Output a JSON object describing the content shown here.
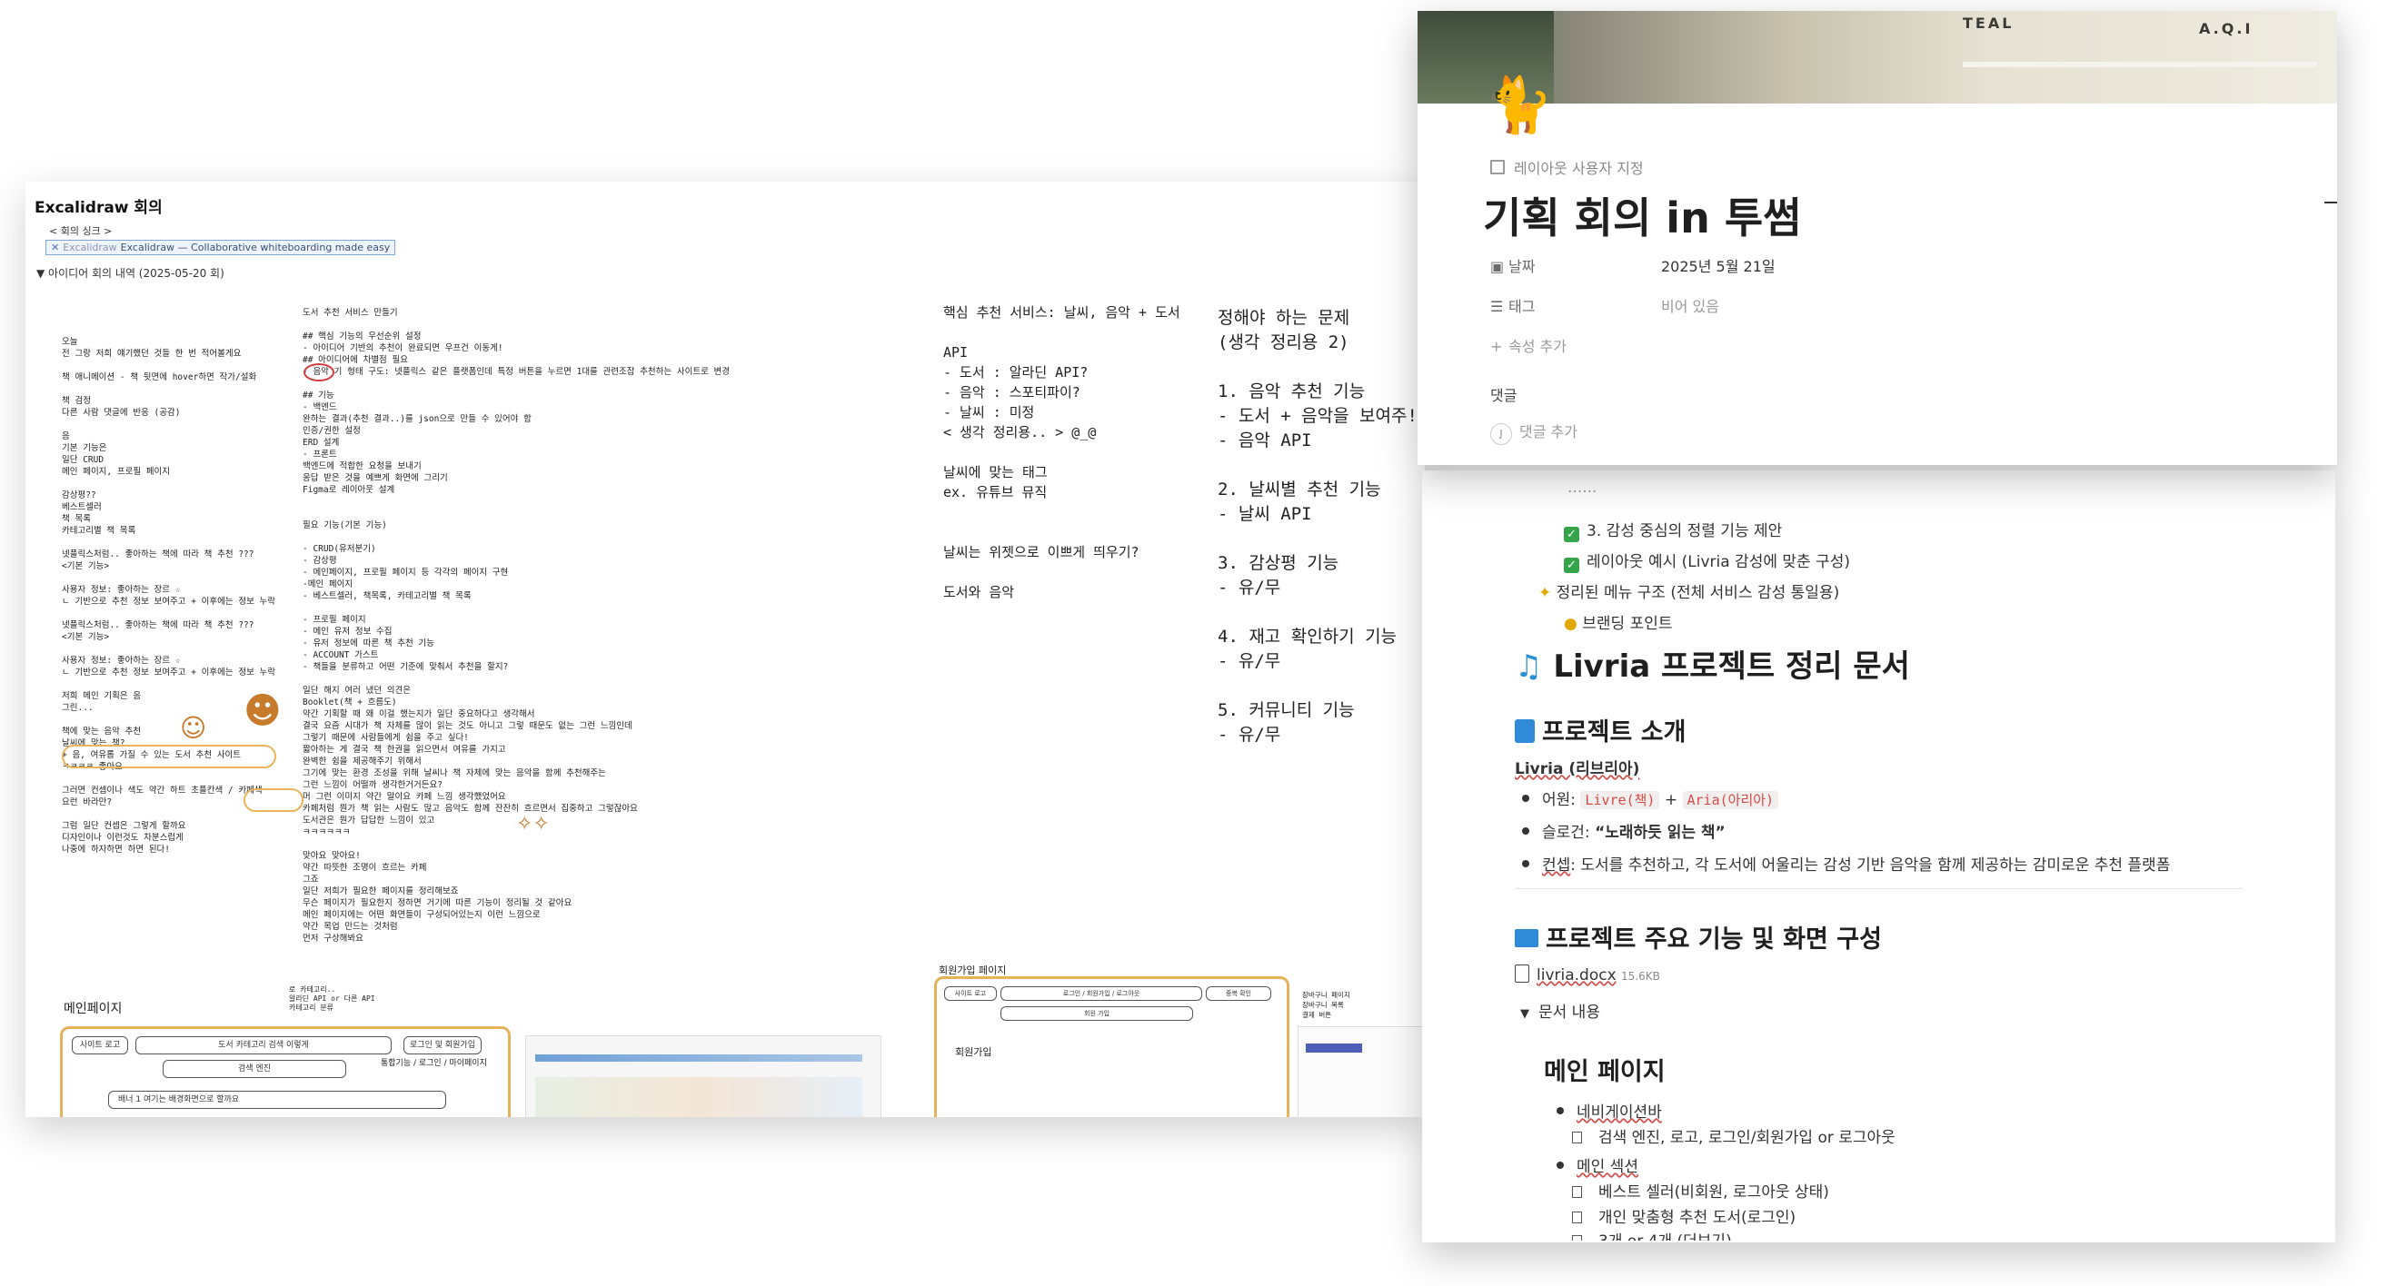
{
  "excalidraw": {
    "title": "Excalidraw 회의",
    "sync_label": "< 회의 싱크 >",
    "link_icon": "excalidraw-x-icon",
    "link_text_prefix": "Excalidraw",
    "link_text": "Excalidraw — Collaborative whiteboarding made easy",
    "toggle_label": "아이디어 회의 내역 (2025-05-20 회)",
    "notes": {
      "col1": "오늘\n전 그랑 저희 얘기했던 것들 한 번 적어볼게요\n\n책 애니메이션 - 책 뒷면에 hover하면 작가/설화\n\n책 검정\n다른 사람 댓글에 반응 (공감)\n\n음\n기본 기능은\n일단 CRUD\n메인 페이지, 프로필 페이지\n\n감상평??\n베스트셀러\n책 목록\n카테고리별 책 목록\n\n넷플릭스처럼.. 좋아하는 책에 따라 책 추천 ???\n<기본 기능>\n\n사용자 정보: 좋아하는 장르 ☆\nㄴ 기반으로 추천 정보 보여주고 + 이후에는 정보 누락\n\n넷플릭스처럼.. 좋아하는 책에 따라 책 추천 ???\n<기본 기능>\n\n사용자 정보: 좋아하는 장르 ☆\nㄴ 기반으로 추천 정보 보여주고 + 이후에는 정보 누락\n\n저희 메인 기획은 음\n그린...\n\n책에 맞는 음악 추천\n날씨에 맞는 책?\n+ 음, 여유롭 가질 수 있는 도서 추천 사이트\nㅋㅋㅋㅋ 좋아요\n\n그러면 컨셉이나 색도 약간 하트 초플칸색 / 카페색\n요런 바라만?\n\n그럼 일단 컨셉은 그렇게 할까요\n디자인이나 이런것도 차분스럽게\n나중에 하자하면 하면 된다!",
      "col2": "도서 추천 서비스 만들기\n\n## 핵심 기능의 우선순위 설정\n- 아이디어 기반의 추천이 완료되면 우프건 이동게!\n## 아이디어에 차별점 필요\n- 음악 기 형태 구도: 넷플릭스 같은 플랫폼인데 특정 버튼을 누르면 1대를 관련조잡 추천하는 사이트로 변경\n\n## 기능\n- 백엔드\n  완하는 결과(추천 결과..)를 json으로 만들 수 있어야 함\n  인증/권한 설정\n  ERD 설계\n- 프론트\n  백엔드에 적합한 요청을 보내기\n  응답 받은 것을 예쁘게 화면에 그리기\n  Figma로 레이아웃 설계\n\n\n필요 기능(기본 기능)\n\n- CRUD(유저분기)\n  - 감상평\n- 메인페이지, 프로필 페이지 등 각각의 페이지 구현\n  -메인 페이지\n    - 베스트셀러, 책목록, 카테고리별 책 목록\n\n  - 프로필 페이지\n    - 메인 유저 정보 수집\n    - 유저 정보에 따른 책 추천 기능\n      - ACCOUNT 가스트\n      - 책들을 분류하고 어떤 기준에 맞춰서 추천을 할지?\n\n일단 해지 여러 냈던 의견은\nBooklet(책 + 흐름도)\n약간 기획할 때 왜 이걸 했는지가 일단 중요하다고 생각해서\n결국 요즘 시대가 책 자체를 많이 읽는 것도 아니고 그렇 때문도 없는 그런 느낌인데\n그렇기 때문에 사람들에게 쉼을 주고 싶다!\n짧아하는 게 결국 책 한권을 읽으면서 여유를 가지고\n완벽한 쉼을 제공해주기 위해서\n그기에 맞는 환경 조성을 위해 날씨나 책 자체에 맞는 음악을 함께 추천해주는\n그런 느낌이 어떨까 생각한거거든요?\n머 그런 이미지 약간 말이요 카페 느낌 생각했었어요\n카페처럼 뭔가 책 읽는 사람도 많고 음악도 함께 잔잔히 흐르면서 집중하고 그렇잖아요\n도서관은 뭔가 답답한 느낌이 있고\nㅋㅋㅋㅋㅋㅋ\n\n맞아요 맞아요!\n약간 따뜻한 조명이 흐르는 카페\n그죠\n일단 저희가 필요한 페이지를 정리해보죠\n무슨 페이지가 필요한지 정하면 거기에 따른 기능이 정리될 것 같아요\n메인 페이지에는 어떤 화면들이 구성되어있는지 이런 느낌으로\n약간 목업 만드는 것처럼\n먼저 구상해봐요",
      "col3": "핵심 추천 서비스: 날씨, 음악 + 도서\n\nAPI\n- 도서 : 알라딘 API?\n- 음악 : 스포티파이?\n- 날씨 : 미정\n< 생각 정리용.. > @_@\n\n날씨에 맞는 태그\nex. 유튜브 뮤직\n\n\n날씨는 위젯으로 이쁘게 띄우기?\n\n도서와 음악",
      "col4": "정해야 하는 문제\n(생각 정리용 2)\n\n1. 음악 추천 기능\n- 도서 + 음악을 보여주!\n- 음악 API\n\n2. 날씨별 추천 기능\n- 날씨 API\n\n3. 감상평 기능\n- 유/무\n\n4. 재고 확인하기 기능\n- 유/무\n\n5. 커뮤니티 기능\n- 유/무"
    },
    "wireframe": {
      "main_page_label": "메인페이지",
      "callout": "로 카테고리..\n알라딘 API or 다른 API\n카테고리 분류",
      "search_box": "도서 카테고리 검색 이렇게",
      "logo_box": "사이트 로고",
      "login_box": "로그인 및 회원가입",
      "nav_text": "통합기능 / 로그인 / 마이페이지",
      "search_btn": "검색 엔진",
      "banner_text": "배너 1  여기는 배경화면으로 할까요",
      "signup_title": "회원가입 페이지",
      "signup_label": "회원가입",
      "signup_box1": "사이트 로고",
      "signup_box2": "로그인 / 회원가입 / 로그아웃",
      "signup_box3": "중복 확인",
      "signup_box4": "회원 가입",
      "side_title": "장바구니 페이지\n장바구니 목록\n결제 버튼"
    }
  },
  "notion": {
    "cover_sign_1": "TEAL",
    "cover_sign_2": "A.Q.I",
    "page_icon": "black-cat-icon",
    "layout_note": "레이아웃 사용자 지정",
    "title": "기획 회의 in 투썸",
    "props": {
      "date_label": "날짜",
      "date_value": "2025년 5월 21일",
      "tags_label": "태그",
      "tags_value": "비어 있음",
      "add_prop": "속성 추가"
    },
    "comments_label": "댓글",
    "comment_add": "댓글 추가",
    "comment_avatar": "J",
    "checklist": [
      "3. 감성 중심의 정렬 기능 제안",
      "레이아웃 예시 (Livria 감성에 맞춘 구성)"
    ],
    "sparkle_item": "정리된 메뉴 구조 (전체 서비스 감성 통일용)",
    "bulb_item": "브랜딩 포인트",
    "doc_title": "Livria 프로젝트 정리 문서",
    "intro_heading": "프로젝트 소개",
    "brand": "Livria (리브리아)",
    "etym_label": "어원:",
    "etym_code1": "Livre(책)",
    "etym_plus": "+",
    "etym_code2": "Aria(아리아)",
    "slogan_label": "슬로건:",
    "slogan_value": "“노래하듯 읽는 책”",
    "concept_label": "컨셉",
    "concept_value": ": 도서를 추천하고, 각 도서에 어울리는 감성 기반 음악을 함께 제공하는 감미로운 추천 플랫폼",
    "features_heading": "프로젝트 주요 기능 및 화면 구성",
    "file_name": "livria.docx",
    "file_size": "15.6KB",
    "doc_toggle": "문서 내용",
    "main_page_heading": "메인 페이지",
    "bullets": [
      {
        "label": "네비게이션바",
        "subs": [
          "검색 엔진, 로고, 로그인/회원가입 or 로그아웃"
        ]
      },
      {
        "label": "메인 섹션",
        "subs": [
          "베스트 셀러(비회원, 로그아웃 상태)",
          "개인 맞춤형 추천 도서(로그인)",
          "3개 or 4개 (더보기)"
        ]
      }
    ]
  }
}
